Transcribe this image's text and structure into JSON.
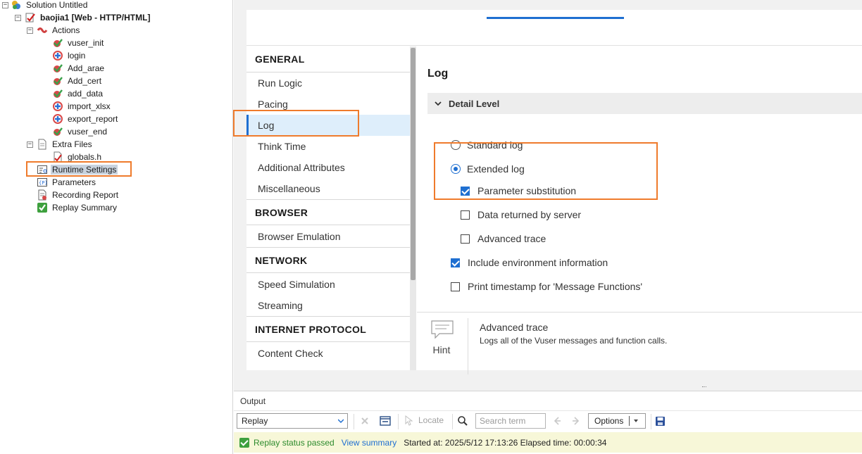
{
  "tree": {
    "solution": "Solution Untitled",
    "script": "baojia1 [Web - HTTP/HTML]",
    "actions": "Actions",
    "action_items": [
      "vuser_init",
      "login",
      "Add_arae",
      "Add_cert",
      "add_data",
      "import_xlsx",
      "export_report",
      "vuser_end"
    ],
    "extra_files": "Extra Files",
    "globals": "globals.h",
    "runtime_settings": "Runtime Settings",
    "parameters": "Parameters",
    "recording_report": "Recording Report",
    "replay_summary": "Replay Summary"
  },
  "categories": {
    "general": "GENERAL",
    "general_items": [
      "Run Logic",
      "Pacing",
      "Log",
      "Think Time",
      "Additional Attributes",
      "Miscellaneous"
    ],
    "browser": "BROWSER",
    "browser_items": [
      "Browser Emulation"
    ],
    "network": "NETWORK",
    "network_items": [
      "Speed Simulation",
      "Streaming"
    ],
    "internet_protocol": "INTERNET PROTOCOL",
    "internet_items": [
      "Content Check"
    ],
    "selected": "Log"
  },
  "log": {
    "title": "Log",
    "section": "Detail Level",
    "standard": "Standard log",
    "extended": "Extended log",
    "param_sub": "Parameter substitution",
    "data_returned": "Data returned by server",
    "advanced_trace": "Advanced trace",
    "include_env": "Include environment information",
    "print_ts": "Print timestamp for 'Message Functions'",
    "states": {
      "standard": false,
      "extended": true,
      "param_sub": true,
      "data_returned": false,
      "advanced_trace": false,
      "include_env": true,
      "print_ts": false
    }
  },
  "hint": {
    "label": "Hint",
    "title": "Advanced trace",
    "text": "Logs all of the Vuser messages and function calls."
  },
  "output": {
    "title": "Output",
    "dropdown": "Replay",
    "locate": "Locate",
    "search_placeholder": "Search term",
    "options": "Options",
    "status": "Replay status passed",
    "view_summary": "View summary",
    "started": "Started at: 2025/5/12 17:13:26 Elapsed time: 00:00:34"
  },
  "colors": {
    "accent": "#1f6fd1",
    "highlight": "#ef7b2c",
    "passed": "#2c8a2c",
    "status_bg": "#f7f7d8"
  }
}
